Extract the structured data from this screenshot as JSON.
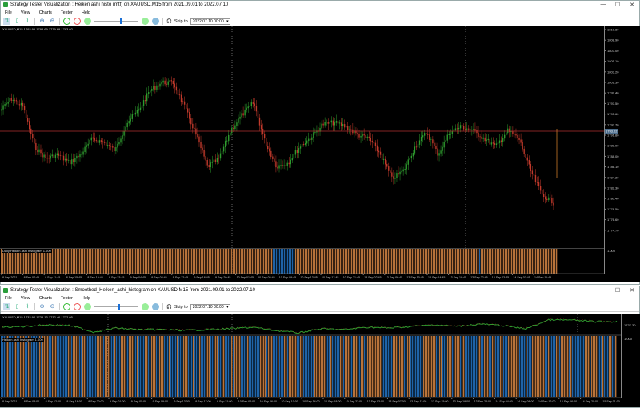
{
  "window1": {
    "title": "Strategy Tester Visualization : Heiken ashi histo (mtf) on XAUUSD,M15 from 2021.09.01 to 2022.07.10",
    "menu": [
      "File",
      "View",
      "Charts",
      "Tester",
      "Help"
    ],
    "skip_label": "Skip to",
    "skip_date": "2022.07.10 00:00",
    "ohlc": "XAUUSD,M15  1793.95 1793.69 1779.69 1793.02",
    "indicator_label": "Daily Heiken ashi histogram 1.000",
    "price_labels": [
      "1810.80",
      "1808.90",
      "1807.00",
      "1805.10",
      "1803.20",
      "1801.30",
      "1799.40",
      "1797.50",
      "1795.60",
      "1793.70",
      "1791.80",
      "1789.90",
      "1788.00",
      "1786.10",
      "1784.20",
      "1782.30",
      "1780.40",
      "1778.50",
      "1776.60",
      "1774.70"
    ],
    "current_price": "1793.02",
    "indicator_scale": "1.000",
    "time_labels": [
      "8 Sep 2021",
      "8 Sep 07:45",
      "8 Sep 11:45",
      "8 Sep 15:45",
      "8 Sep 19:45",
      "8 Sep 23:45",
      "9 Sep 04:45",
      "9 Sep 08:45",
      "9 Sep 12:45",
      "9 Sep 16:45",
      "9 Sep 20:45",
      "10 Sep 01:45",
      "10 Sep 05:45",
      "10 Sep 09:45",
      "10 Sep 13:45",
      "10 Sep 17:45",
      "10 Sep 21:45",
      "13 Sep 02:45",
      "13 Sep 06:45",
      "13 Sep 10:45",
      "13 Sep 14:45",
      "13 Sep 18:45",
      "13 Sep 22:45",
      "14 Sep 03:45",
      "14 Sep 07:45",
      "14 Sep 11:45"
    ]
  },
  "window2": {
    "title": "Strategy Tester Visualization : Smoothed_Heiken_ashi_histogram on XAUUSD,M15 from 2021.09.01 to 2022.07.10",
    "menu": [
      "File",
      "View",
      "Charts",
      "Tester",
      "Help"
    ],
    "skip_label": "Skip to",
    "skip_date": "2022.07.10 00:00",
    "ohlc": "XAUUSD,M15  1732.92 1733.13 1732.46 1732.05",
    "indicator_label": "Heiken ashi histogram 1.000",
    "price_label": "1737.30",
    "indicator_scale": "1.000",
    "time_labels": [
      "8 Sep 2021",
      "8 Sep 08:00",
      "8 Sep 12:00",
      "8 Sep 16:00",
      "8 Sep 20:00",
      "9 Sep 01:00",
      "9 Sep 05:00",
      "9 Sep 09:00",
      "9 Sep 13:00",
      "9 Sep 17:00",
      "9 Sep 21:00",
      "10 Sep 02:00",
      "10 Sep 06:00",
      "10 Sep 10:00",
      "10 Sep 14:00",
      "10 Sep 18:00",
      "10 Sep 22:00",
      "13 Sep 03:00",
      "13 Sep 07:00",
      "13 Sep 11:00",
      "13 Sep 15:00",
      "13 Sep 19:00",
      "13 Sep 23:00",
      "14 Sep 04:00",
      "14 Sep 08:00",
      "14 Sep 12:00",
      "14 Sep 16:00",
      "14 Sep 20:00",
      "15 Sep 01:00"
    ]
  },
  "colors": {
    "bull": "#2e9b2e",
    "bear": "#c0392b",
    "hist_up": "#1f63a8",
    "hist_down": "#b8733a",
    "price_line": "#b03030"
  },
  "window_controls": [
    "minimize",
    "maximize",
    "close"
  ]
}
